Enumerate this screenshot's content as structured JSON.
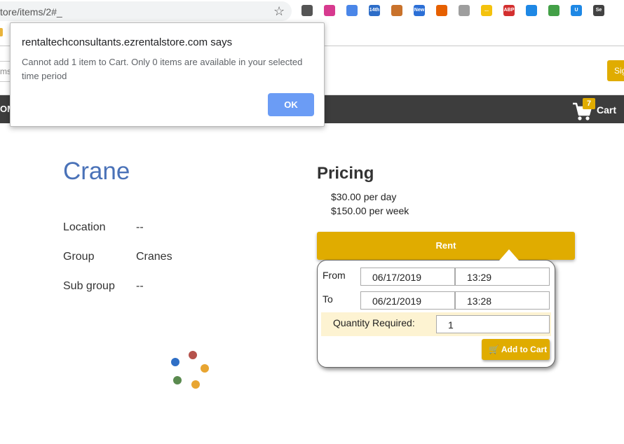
{
  "browser": {
    "url": "tore/items/2#_",
    "extensions": [
      {
        "name": "settings-extension-icon",
        "color": "#555555",
        "text": ""
      },
      {
        "name": "colorpicker-extension-icon",
        "color": "#d73a8f",
        "text": ""
      },
      {
        "name": "translate-extension-icon",
        "color": "#4a86e8",
        "text": ""
      },
      {
        "name": "calendar-extension-icon",
        "color": "#2d6dc8",
        "text": "14th"
      },
      {
        "name": "paint-extension-icon",
        "color": "#c9722b",
        "text": ""
      },
      {
        "name": "new-extension-icon",
        "color": "#2b6fd6",
        "text": "New"
      },
      {
        "name": "firefox-extension-icon",
        "color": "#e66000",
        "text": ""
      },
      {
        "name": "reader-extension-icon",
        "color": "#9e9e9e",
        "text": ""
      },
      {
        "name": "notes-extension-icon",
        "color": "#f4c20d",
        "text": "..."
      },
      {
        "name": "adblock-extension-icon",
        "color": "#d32f2f",
        "text": "ABP"
      },
      {
        "name": "window-extension-icon",
        "color": "#1e88e5",
        "text": ""
      },
      {
        "name": "mail-extension-icon",
        "color": "#43a047",
        "text": ""
      },
      {
        "name": "u-extension-icon",
        "color": "#1e88e5",
        "text": "U"
      },
      {
        "name": "selenium-extension-icon",
        "color": "#424242",
        "text": "Se"
      }
    ]
  },
  "header": {
    "search_stub": "ms",
    "signin_label": "Sig",
    "nav_stub": "OM",
    "cart_count": "7",
    "cart_label": "Cart"
  },
  "product": {
    "title": "Crane",
    "attributes": [
      {
        "label": "Location",
        "value": "--"
      },
      {
        "label": "Group",
        "value": "Cranes"
      },
      {
        "label": "Sub group",
        "value": "--"
      }
    ]
  },
  "pricing": {
    "heading": "Pricing",
    "per_day": "$30.00 per day",
    "per_week": "$150.00 per week",
    "rent_label": "Rent"
  },
  "rent_form": {
    "from_label": "From",
    "from_date": "06/17/2019",
    "from_time": "13:29",
    "to_label": "To",
    "to_date": "06/21/2019",
    "to_time": "13:28",
    "quantity_label": "Quantity Required:",
    "quantity_value": "1",
    "add_to_cart_label": "Add to Cart"
  },
  "dialog": {
    "title": "rentaltechconsultants.ezrentalstore.com says",
    "message": "Cannot add 1 item to Cart. Only 0 items are available in your selected time period",
    "ok_label": "OK"
  },
  "colors": {
    "accent": "#e0ac00",
    "title_blue": "#4a72b8",
    "nav_dark": "#3d3d3d",
    "ok_blue": "#6b9cf5",
    "spinner": [
      "#b5524b",
      "#e8a531",
      "#e8a531",
      "#5a8a4f",
      "#2f6fc6"
    ]
  }
}
